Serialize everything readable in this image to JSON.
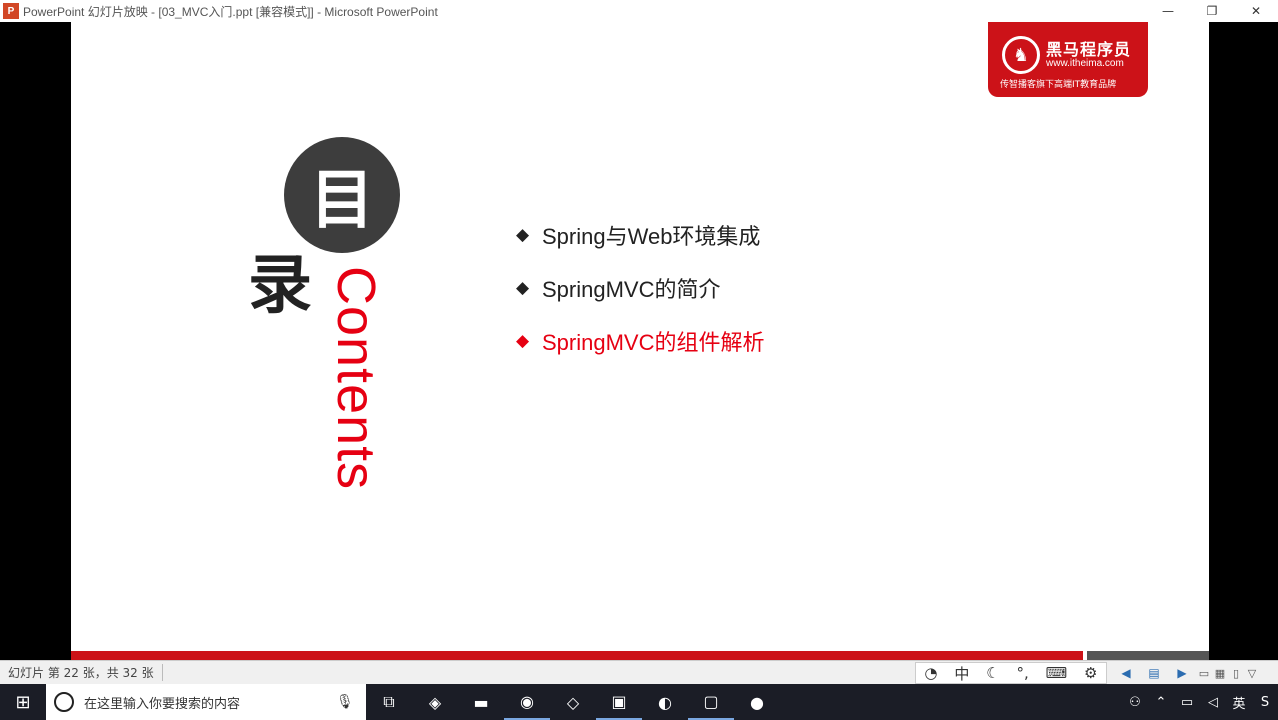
{
  "window": {
    "app_icon": "P",
    "title": "PowerPoint 幻灯片放映 - [03_MVC入门.ppt [兼容模式]] - Microsoft PowerPoint",
    "buttons": [
      "minimize-icon",
      "restore-icon",
      "close-icon"
    ]
  },
  "slide": {
    "brand": {
      "name": "黑马程序员",
      "url": "www.itheima.com",
      "slogan": "传智播客旗下高端IT教育品牌"
    },
    "toc": {
      "char_mu": "目",
      "char_lu": "录",
      "contents": "Contents"
    },
    "menu": [
      {
        "label": "Spring与Web环境集成",
        "active": false
      },
      {
        "label": "SpringMVC的简介",
        "active": false
      },
      {
        "label": "SpringMVC的组件解析",
        "active": true
      }
    ],
    "bullet": "◆",
    "colors": {
      "accent": "#e60012",
      "circle": "#3d3d3d"
    }
  },
  "statusbar": {
    "slide_count": "幻灯片 第 22 张，共 32 张",
    "ime": [
      "中"
    ]
  },
  "taskbar": {
    "search_placeholder": "在这里输入你要搜索的内容",
    "tray": {
      "ime_lang": "英"
    }
  }
}
